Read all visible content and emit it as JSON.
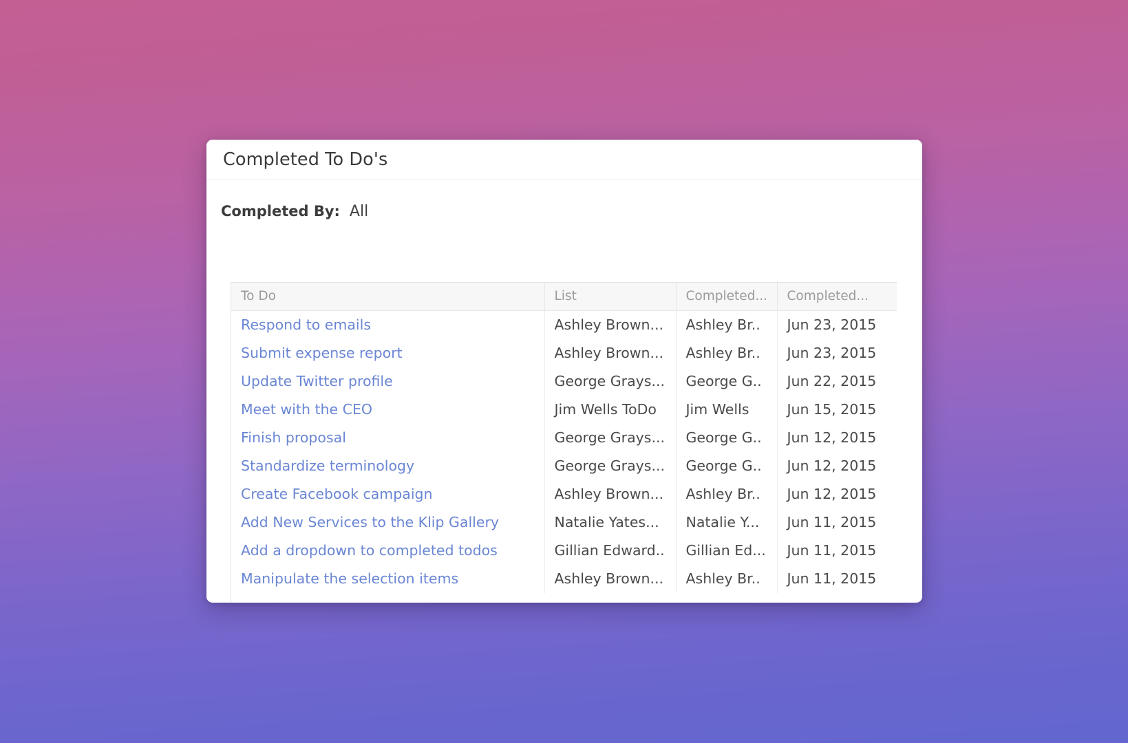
{
  "dialog": {
    "title": "Completed To Do's"
  },
  "filter": {
    "label": "Completed By:",
    "value": "All"
  },
  "table": {
    "headers": [
      {
        "key": "todo",
        "label": "To Do"
      },
      {
        "key": "list",
        "label": "List"
      },
      {
        "key": "completed_by",
        "label": "Completed..."
      },
      {
        "key": "completed_date",
        "label": "Completed..."
      }
    ],
    "rows": [
      {
        "todo": "Respond to emails",
        "list": "Ashley Brown...",
        "completed_by": "Ashley Br..",
        "completed_date": "Jun 23, 2015"
      },
      {
        "todo": "Submit expense report",
        "list": "Ashley Brown...",
        "completed_by": "Ashley Br..",
        "completed_date": "Jun 23, 2015"
      },
      {
        "todo": "Update Twitter profile",
        "list": "George Grays...",
        "completed_by": "George G..",
        "completed_date": "Jun 22, 2015"
      },
      {
        "todo": "Meet with the CEO",
        "list": "Jim Wells ToDo",
        "completed_by": "Jim Wells",
        "completed_date": "Jun 15, 2015"
      },
      {
        "todo": "Finish proposal",
        "list": "George Grays...",
        "completed_by": "George G..",
        "completed_date": "Jun 12, 2015"
      },
      {
        "todo": "Standardize terminology",
        "list": "George Grays...",
        "completed_by": "George G..",
        "completed_date": "Jun 12, 2015"
      },
      {
        "todo": "Create Facebook campaign",
        "list": "Ashley Brown...",
        "completed_by": "Ashley Br..",
        "completed_date": "Jun 12, 2015"
      },
      {
        "todo": "Add New Services to the Klip Gallery",
        "list": "Natalie Yates...",
        "completed_by": "Natalie Y...",
        "completed_date": "Jun 11, 2015"
      },
      {
        "todo": "Add a dropdown to completed todos",
        "list": "Gillian Edward..",
        "completed_by": "Gillian Ed...",
        "completed_date": "Jun 11, 2015"
      },
      {
        "todo": "Manipulate the selection items",
        "list": "Ashley Brown...",
        "completed_by": "Ashley Br..",
        "completed_date": "Jun 11, 2015"
      }
    ]
  },
  "colors": {
    "link": "#6a86d4",
    "header_text": "#9a9a9a",
    "body_text": "#4a4a4a",
    "background_top": "#c45f93",
    "background_bottom": "#6366cf"
  }
}
